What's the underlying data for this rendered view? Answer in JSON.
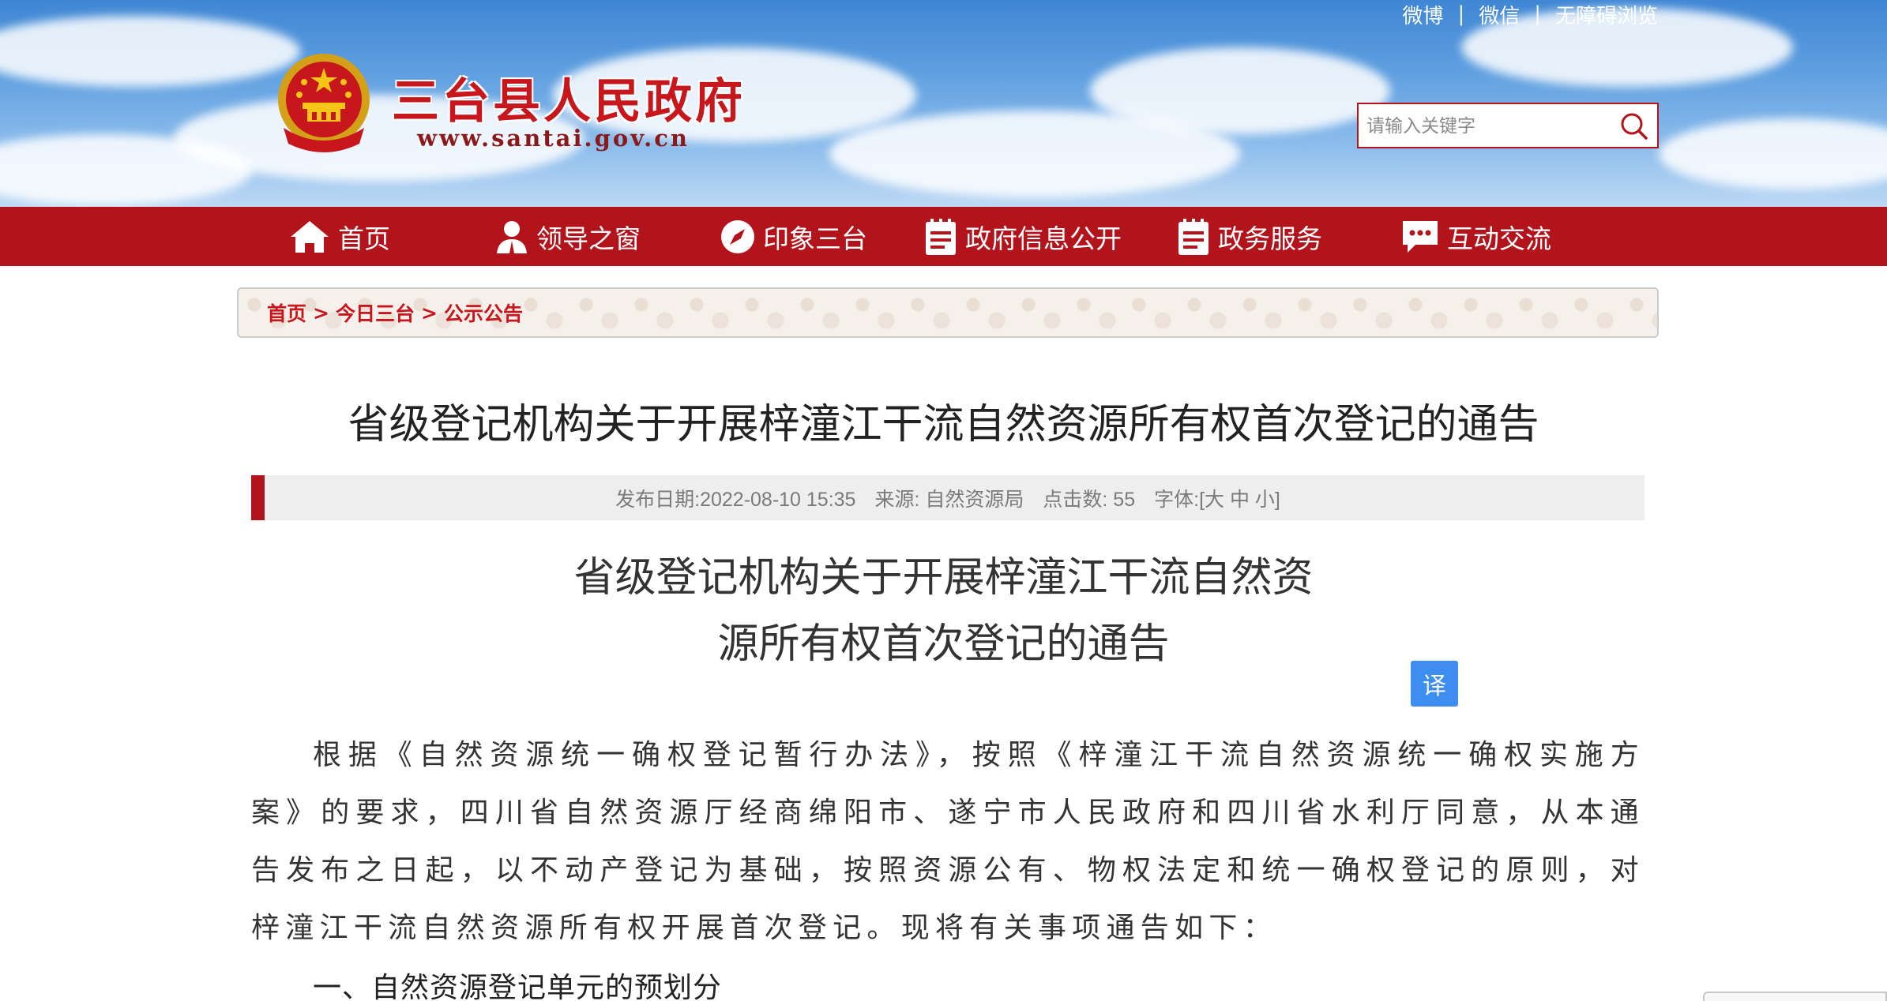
{
  "header": {
    "site_title": "三台县人民政府",
    "site_url": "www.santai.gov.cn",
    "top_links": [
      "微博",
      "微信",
      "无障碍浏览"
    ],
    "search_placeholder": "请输入关键字"
  },
  "nav": {
    "items": [
      {
        "label": "首页",
        "icon": "home-icon"
      },
      {
        "label": "领导之窗",
        "icon": "person-icon"
      },
      {
        "label": "印象三台",
        "icon": "compass-icon"
      },
      {
        "label": "政府信息公开",
        "icon": "document-icon"
      },
      {
        "label": "政务服务",
        "icon": "document-icon"
      },
      {
        "label": "互动交流",
        "icon": "chat-icon"
      }
    ]
  },
  "breadcrumb": {
    "items": [
      "首页",
      "今日三台",
      "公示公告"
    ],
    "separator": ">"
  },
  "article": {
    "page_title": "省级登记机构关于开展梓潼江干流自然资源所有权首次登记的通告",
    "meta": {
      "date_label": "发布日期:",
      "date": "2022-08-10 15:35",
      "source_label": "来源:",
      "source": "自然资源局",
      "clicks_label": "点击数:",
      "clicks": "55",
      "font_label": "字体:",
      "font_sizes": "[大 中 小]"
    },
    "doc_title_line1": "省级登记机构关于开展梓潼江干流自然资",
    "doc_title_line2": "源所有权首次登记的通告",
    "translate_label": "译",
    "paragraph1": "根据《自然资源统一确权登记暂行办法》，按照《梓潼江干流自然资源统一确权实施方案》的要求，四川省自然资源厅经商绵阳市、遂宁市人民政府和四川省水利厅同意，从本通告发布之日起，以不动产登记为基础，按照资源公有、物权法定和统一确权登记的原则，对梓潼江干流自然资源所有权开展首次登记。现将有关事项通告如下：",
    "section1_heading": "一、自然资源登记单元的预划分"
  },
  "colors": {
    "brand_red": "#b3141b",
    "title_red": "#c8161d",
    "translate_blue": "#3d8ef0"
  }
}
